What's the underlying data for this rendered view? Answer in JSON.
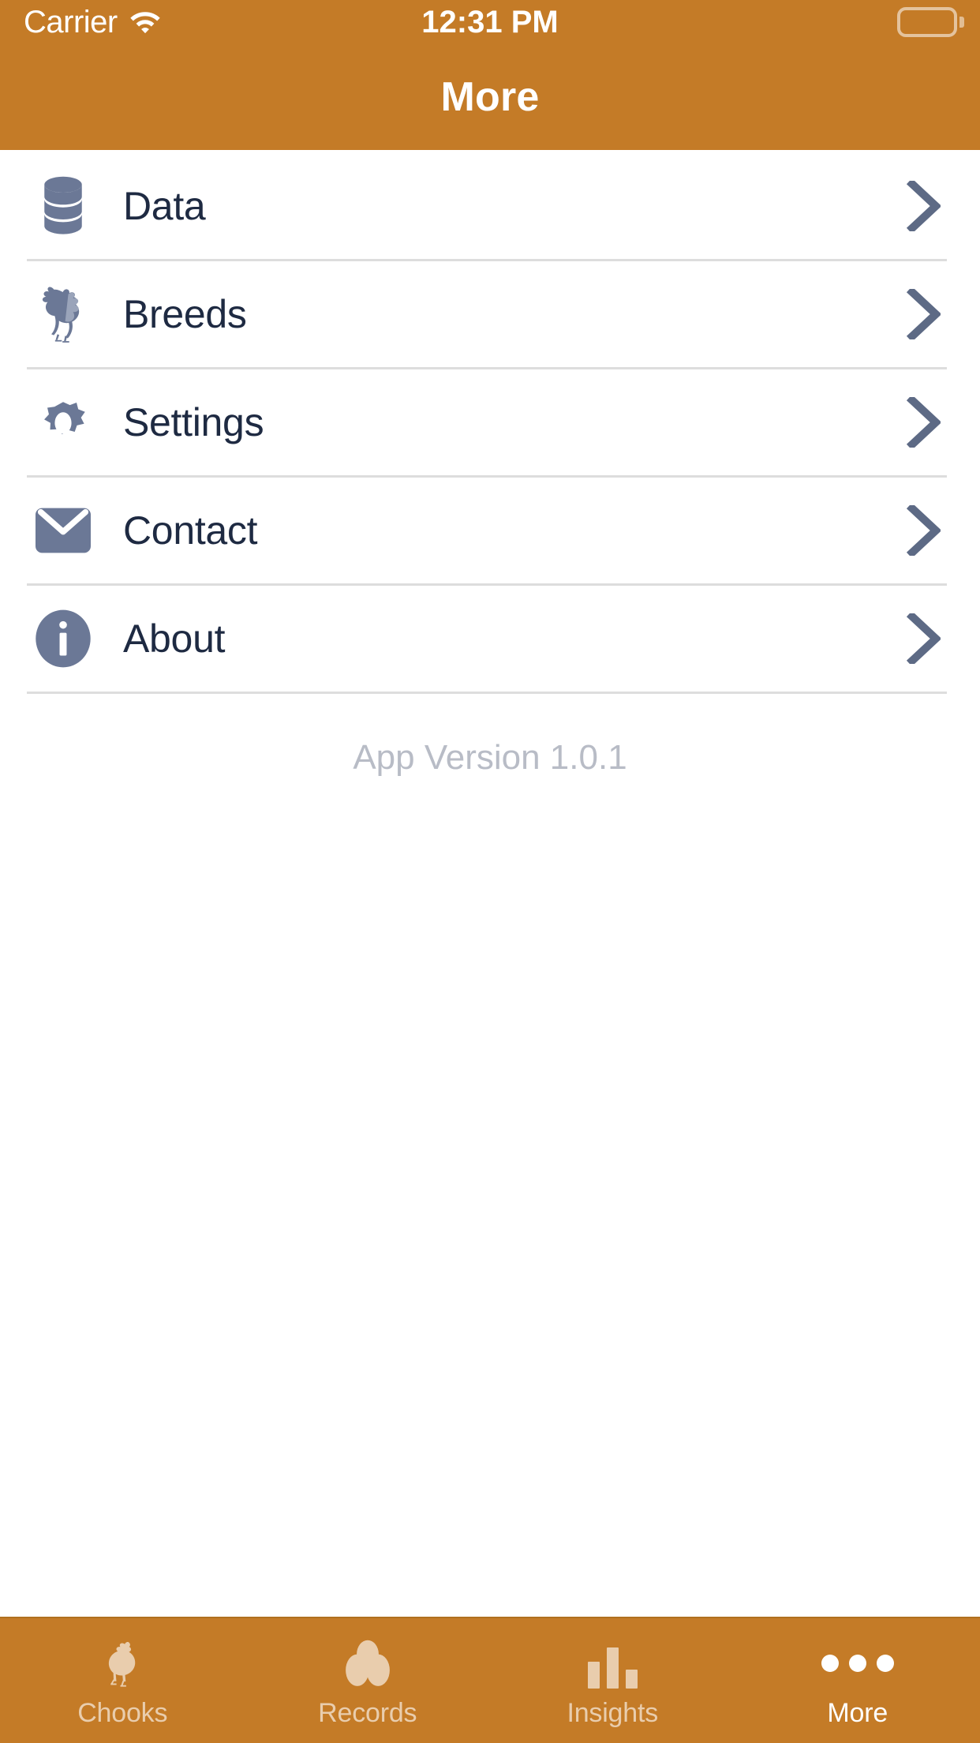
{
  "status_bar": {
    "carrier": "Carrier",
    "wifi_icon": "wifi-icon",
    "time": "12:31 PM",
    "battery_icon": "battery-full-icon"
  },
  "nav_bar": {
    "title": "More"
  },
  "colors": {
    "accent": "#c47b27",
    "icon_slate": "#6b7896",
    "text_dark": "#1e2a42",
    "divider": "#dddddd",
    "version_text": "#b8bcc6",
    "tab_inactive": "#e9cdad",
    "tab_active": "#ffffff"
  },
  "menu": {
    "items": [
      {
        "label": "Data",
        "icon": "database-icon",
        "chevron": "chevron-right-icon"
      },
      {
        "label": "Breeds",
        "icon": "rooster-icon",
        "chevron": "chevron-right-icon"
      },
      {
        "label": "Settings",
        "icon": "gear-icon",
        "chevron": "chevron-right-icon"
      },
      {
        "label": "Contact",
        "icon": "envelope-icon",
        "chevron": "chevron-right-icon"
      },
      {
        "label": "About",
        "icon": "info-circle-icon",
        "chevron": "chevron-right-icon"
      }
    ]
  },
  "footer": {
    "version": "App Version 1.0.1"
  },
  "tab_bar": {
    "tabs": [
      {
        "label": "Chooks",
        "icon": "chicken-icon",
        "active": false
      },
      {
        "label": "Records",
        "icon": "eggs-icon",
        "active": false
      },
      {
        "label": "Insights",
        "icon": "bar-chart-icon",
        "active": false
      },
      {
        "label": "More",
        "icon": "ellipsis-icon",
        "active": true
      }
    ]
  }
}
